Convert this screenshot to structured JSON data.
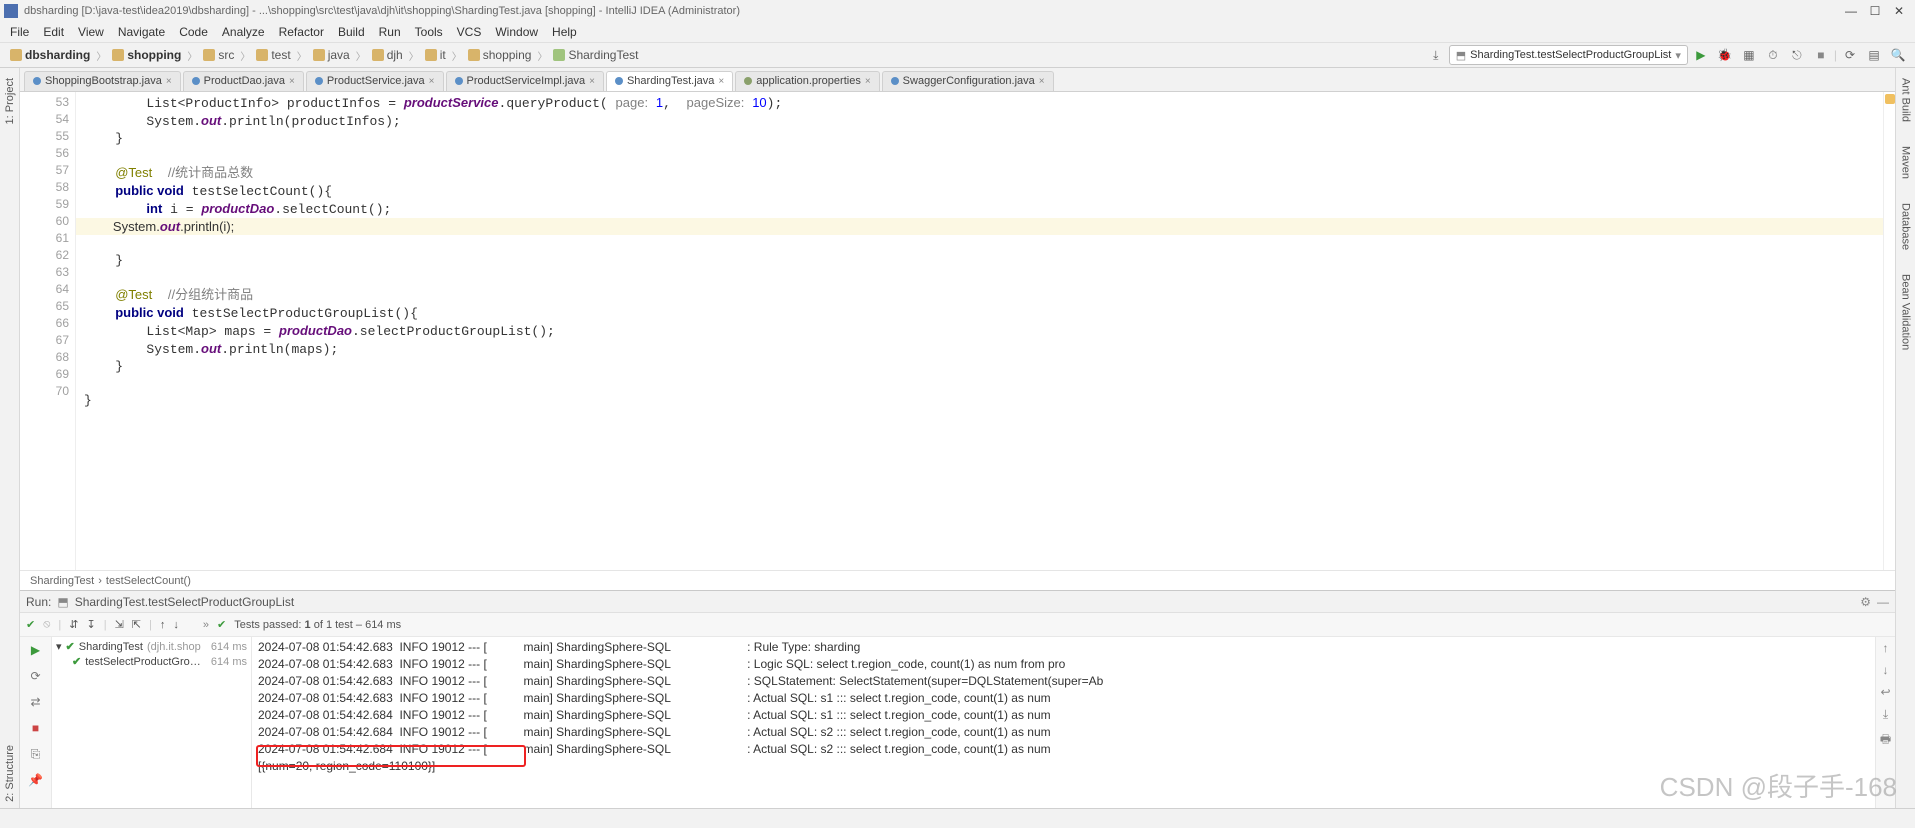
{
  "title_bar": "dbsharding [D:\\java-test\\idea2019\\dbsharding] - ...\\shopping\\src\\test\\java\\djh\\it\\shopping\\ShardingTest.java [shopping] - IntelliJ IDEA (Administrator)",
  "menu": [
    "File",
    "Edit",
    "View",
    "Navigate",
    "Code",
    "Analyze",
    "Refactor",
    "Build",
    "Run",
    "Tools",
    "VCS",
    "Window",
    "Help"
  ],
  "crumbs": [
    "dbsharding",
    "shopping",
    "src",
    "test",
    "java",
    "djh",
    "it",
    "shopping",
    "ShardingTest"
  ],
  "run_combo": "ShardingTest.testSelectProductGroupList",
  "tabs": [
    {
      "label": "ShoppingBootstrap.java",
      "type": "java",
      "active": false
    },
    {
      "label": "ProductDao.java",
      "type": "java",
      "active": false
    },
    {
      "label": "ProductService.java",
      "type": "java",
      "active": false
    },
    {
      "label": "ProductServiceImpl.java",
      "type": "java",
      "active": false
    },
    {
      "label": "ShardingTest.java",
      "type": "java",
      "active": true
    },
    {
      "label": "application.properties",
      "type": "prop",
      "active": false
    },
    {
      "label": "SwaggerConfiguration.java",
      "type": "java",
      "active": false
    }
  ],
  "gutter_lines": [
    "53",
    "54",
    "55",
    "56",
    "57",
    "58",
    "59",
    "60",
    "61",
    "62",
    "63",
    "64",
    "65",
    "66",
    "67",
    "68",
    "69",
    "70"
  ],
  "breadcrumb_bottom": {
    "a": "ShardingTest",
    "b": "testSelectCount()"
  },
  "left_tabs": [
    "1: Project"
  ],
  "left_tabs_lower": [
    "2: Structure"
  ],
  "right_tabs": [
    "Ant Build",
    "Maven",
    "Database",
    "Bean Validation"
  ],
  "run_panel": {
    "label": "Run:",
    "title": "ShardingTest.testSelectProductGroupList",
    "tests_summary": {
      "prefix": "Tests passed: ",
      "count": "1",
      "suffix": " of 1 test – 614 ms"
    },
    "tree": [
      {
        "name": "ShardingTest",
        "pkg": "(djh.it.shop ",
        "time": "614 ms",
        "indent": 0
      },
      {
        "name": "testSelectProductGro…",
        "pkg": "",
        "time": "614 ms",
        "indent": 1
      }
    ],
    "console_lines": [
      "2024-07-08 01:54:42.683  INFO 19012 --- [           main] ShardingSphere-SQL                       : Rule Type: sharding",
      "2024-07-08 01:54:42.683  INFO 19012 --- [           main] ShardingSphere-SQL                       : Logic SQL: select t.region_code, count(1) as num from pro",
      "2024-07-08 01:54:42.683  INFO 19012 --- [           main] ShardingSphere-SQL                       : SQLStatement: SelectStatement(super=DQLStatement(super=Ab",
      "2024-07-08 01:54:42.683  INFO 19012 --- [           main] ShardingSphere-SQL                       : Actual SQL: s1 ::: select t.region_code, count(1) as num ",
      "2024-07-08 01:54:42.684  INFO 19012 --- [           main] ShardingSphere-SQL                       : Actual SQL: s1 ::: select t.region_code, count(1) as num ",
      "2024-07-08 01:54:42.684  INFO 19012 --- [           main] ShardingSphere-SQL                       : Actual SQL: s2 ::: select t.region_code, count(1) as num ",
      "2024-07-08 01:54:42.684  INFO 19012 --- [           main] ShardingSphere-SQL                       : Actual SQL: s2 ::: select t.region_code, count(1) as num ",
      "[{num=20, region_code=110100}]"
    ]
  },
  "watermark": "CSDN @段子手-168"
}
